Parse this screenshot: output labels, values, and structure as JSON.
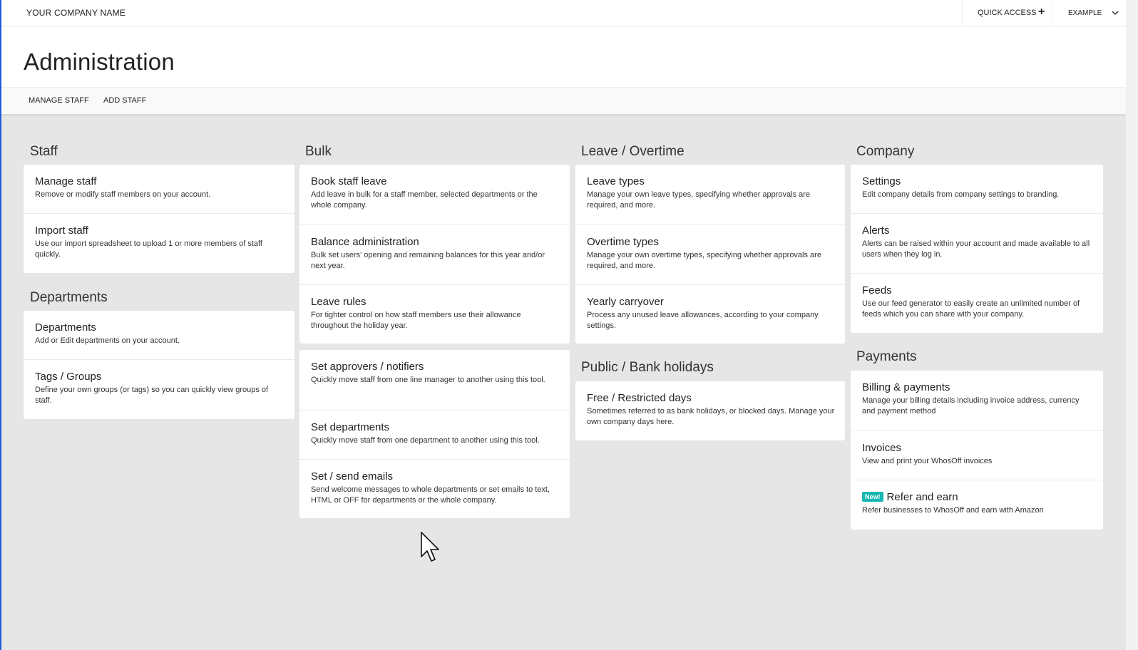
{
  "topbar": {
    "company_name": "YOUR COMPANY NAME",
    "quick_access_label": "QUICK ACCESS",
    "quick_access_icon": "plus-icon",
    "user_menu_label": "EXAMPLE",
    "user_menu_icon": "chevron-down-icon"
  },
  "page": {
    "title": "Administration"
  },
  "subnav": {
    "manage_staff": "MANAGE STAFF",
    "add_staff": "ADD STAFF"
  },
  "sections": {
    "staff": {
      "title": "Staff",
      "items": [
        {
          "title": "Manage staff",
          "desc": "Remove or modify staff members on your account."
        },
        {
          "title": "Import staff",
          "desc": "Use our import spreadsheet to upload 1 or more members of staff quickly."
        }
      ]
    },
    "departments": {
      "title": "Departments",
      "items": [
        {
          "title": "Departments",
          "desc": "Add or Edit departments on your account."
        },
        {
          "title": "Tags / Groups",
          "desc": "Define your own groups (or tags) so you can quickly view groups of staff."
        }
      ]
    },
    "bulk": {
      "title": "Bulk",
      "items": [
        {
          "title": "Book staff leave",
          "desc": "Add leave in bulk for a staff member, selected departments or the whole company."
        },
        {
          "title": "Balance administration",
          "desc": "Bulk set users' opening and remaining balances for this year and/or next year."
        },
        {
          "title": "Leave rules",
          "desc": "For tighter control on how staff members use their allowance throughout the holiday year."
        }
      ]
    },
    "bulk2": {
      "items": [
        {
          "title": "Set approvers / notifiers",
          "desc": "Quickly move staff from one line manager to another using this tool."
        },
        {
          "title": "Set departments",
          "desc": "Quickly move staff from one department to another using this tool."
        },
        {
          "title": "Set / send emails",
          "desc": "Send welcome messages to whole departments or set emails to text, HTML or OFF for departments or the whole company."
        }
      ]
    },
    "leave_overtime": {
      "title": "Leave / Overtime",
      "items": [
        {
          "title": "Leave types",
          "desc": "Manage your own leave types, specifying whether approvals are required, and more."
        },
        {
          "title": "Overtime types",
          "desc": "Manage your own overtime types, specifying whether approvals are required, and more."
        },
        {
          "title": "Yearly carryover",
          "desc": "Process any unused leave allowances, according to your company settings."
        }
      ]
    },
    "public_holidays": {
      "title": "Public / Bank holidays",
      "items": [
        {
          "title": "Free / Restricted days",
          "desc": "Sometimes referred to as bank holidays, or blocked days. Manage your own company days here."
        }
      ]
    },
    "company": {
      "title": "Company",
      "items": [
        {
          "title": "Settings",
          "desc": "Edit company details from company settings to branding."
        },
        {
          "title": "Alerts",
          "desc": "Alerts can be raised within your account and made available to all users when they log in."
        },
        {
          "title": "Feeds",
          "desc": "Use our feed generator to easily create an unlimited number of feeds which you can share with your company."
        }
      ]
    },
    "payments": {
      "title": "Payments",
      "items": [
        {
          "title": "Billing & payments",
          "desc": "Manage your billing details including invoice address, currency and payment method"
        },
        {
          "title": "Invoices",
          "desc": "View and print your WhosOff invoices"
        },
        {
          "title": "Refer and earn",
          "desc": "Refer businesses to WhosOff and earn with Amazon",
          "badge": "New!"
        }
      ]
    }
  },
  "colors": {
    "accent_edge": "#1f5bd6",
    "badge": "#17b6b0",
    "background": "#e6e6e6"
  }
}
